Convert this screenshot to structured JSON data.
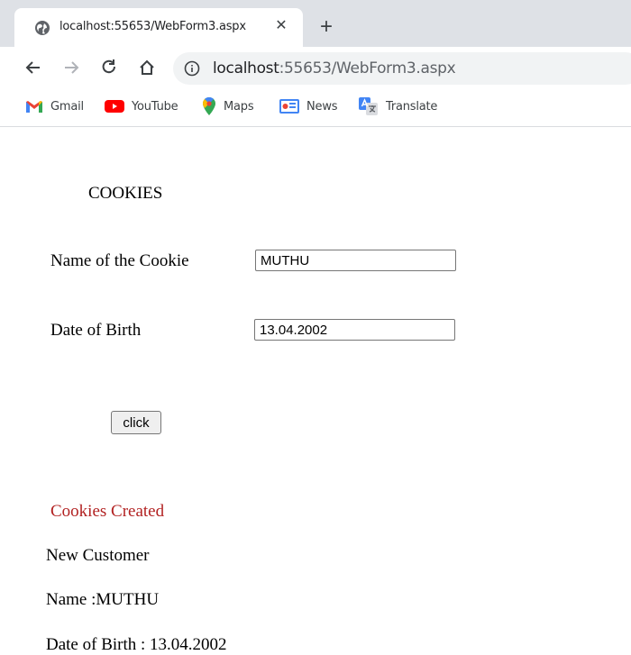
{
  "browser": {
    "tab_title": "localhost:55653/WebForm3.aspx",
    "tab_close": "✕",
    "new_tab": "+",
    "url_host": "localhost",
    "url_rest": ":55653/WebForm3.aspx",
    "bookmarks": [
      {
        "label": "Gmail",
        "icon": "gmail-icon"
      },
      {
        "label": "YouTube",
        "icon": "youtube-icon"
      },
      {
        "label": "Maps",
        "icon": "maps-icon"
      },
      {
        "label": "News",
        "icon": "news-icon"
      },
      {
        "label": "Translate",
        "icon": "translate-icon"
      }
    ]
  },
  "form": {
    "heading": "COOKIES",
    "cookie_name_label": "Name of the Cookie",
    "cookie_name_value": "MUTHU",
    "dob_label": "Date of Birth",
    "dob_value": "13.04.2002",
    "submit_label": "click"
  },
  "result": {
    "status": "Cookies Created",
    "status_color": "#b22222",
    "customer_type": "New Customer",
    "name_line": "Name :MUTHU",
    "dob_line": "Date of Birth : 13.04.2002"
  }
}
